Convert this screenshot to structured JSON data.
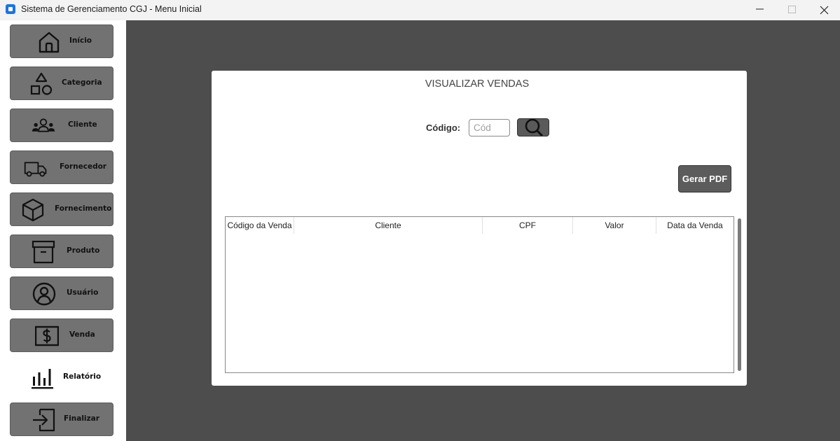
{
  "window": {
    "title": "Sistema de Gerenciamento CGJ - Menu Inicial",
    "controls": [
      "minimize",
      "maximize",
      "close"
    ]
  },
  "sidebar": {
    "items": [
      {
        "label": "Início",
        "icon": "home-icon"
      },
      {
        "label": "Categoria",
        "icon": "shapes-icon"
      },
      {
        "label": "Cliente",
        "icon": "users-icon"
      },
      {
        "label": "Fornecedor",
        "icon": "truck-icon"
      },
      {
        "label": "Fornecimento",
        "icon": "box-icon"
      },
      {
        "label": "Produto",
        "icon": "archive-icon"
      },
      {
        "label": "Usuário",
        "icon": "user-circle-icon"
      },
      {
        "label": "Venda",
        "icon": "dollar-icon"
      },
      {
        "label": "Relatório",
        "icon": "bar-chart-icon",
        "active": true
      },
      {
        "label": "Finalizar",
        "icon": "logout-icon"
      }
    ]
  },
  "panel": {
    "title": "VISUALIZAR VENDAS",
    "code_label": "Código:",
    "code_placeholder": "Cód",
    "code_value": "",
    "search_icon": "search-icon",
    "pdf_button": "Gerar PDF",
    "table": {
      "columns": [
        "Código da Venda",
        "Cliente",
        "CPF",
        "Valor",
        "Data da Venda"
      ],
      "rows": []
    }
  },
  "colors": {
    "main_bg": "#4d4d4d",
    "button_bg": "#727272",
    "panel_bg": "#ffffff"
  }
}
